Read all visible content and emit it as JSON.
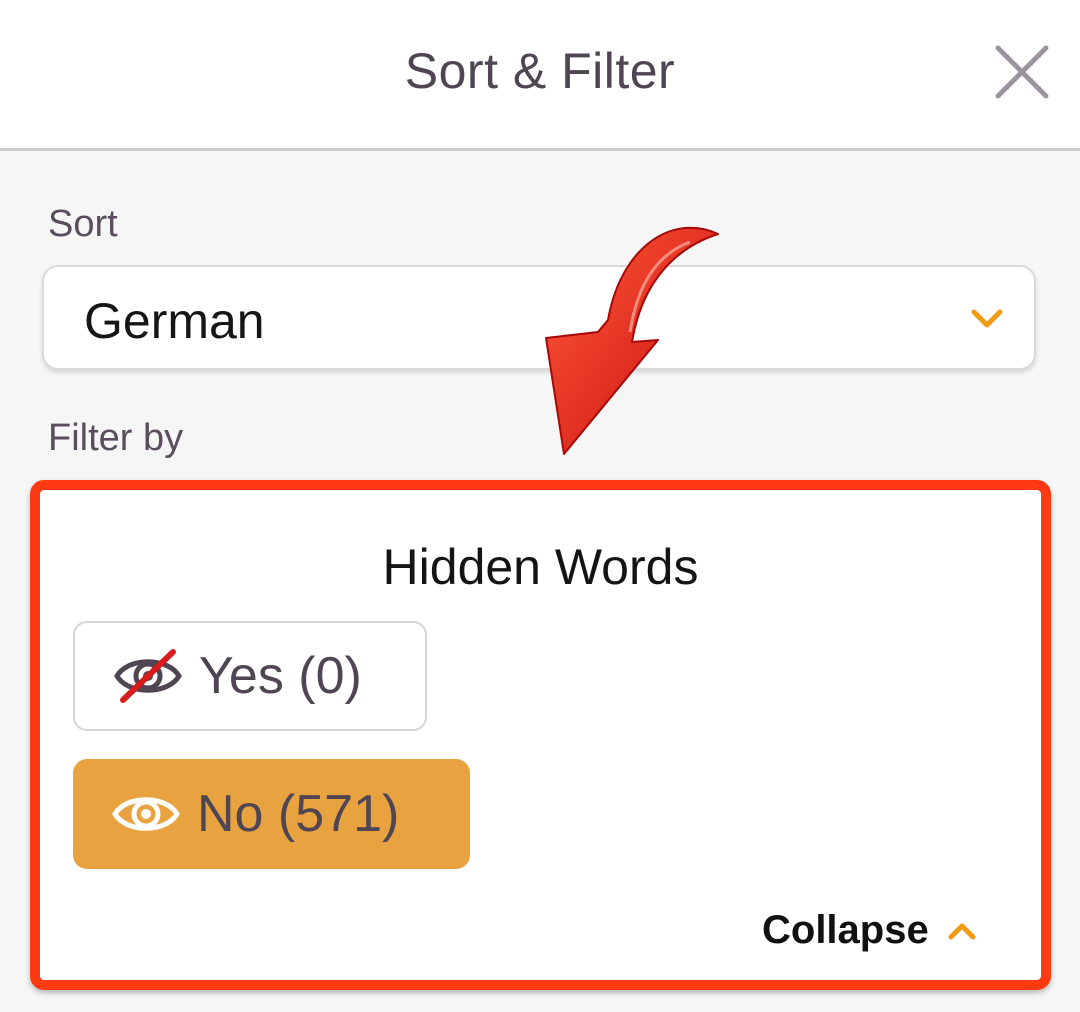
{
  "header": {
    "title": "Sort & Filter",
    "close_icon": "close-icon"
  },
  "sort": {
    "label": "Sort",
    "selected": "German",
    "chevron_icon": "chevron-down-icon"
  },
  "filter": {
    "label": "Filter by",
    "card": {
      "title": "Hidden Words",
      "options": [
        {
          "label": "Yes (0)",
          "icon": "eye-slash-icon",
          "selected": false
        },
        {
          "label": "No (571)",
          "icon": "eye-icon",
          "selected": true
        }
      ],
      "collapse_label": "Collapse",
      "collapse_icon": "chevron-up-icon"
    }
  },
  "annotation": {
    "arrow_icon": "red-curved-arrow-icon",
    "highlight_color": "#ff3a12"
  },
  "colors": {
    "accent": "#e8a23f",
    "chevron": "#f29a12",
    "text_primary": "#4f4553",
    "highlight": "#ff3a12"
  }
}
